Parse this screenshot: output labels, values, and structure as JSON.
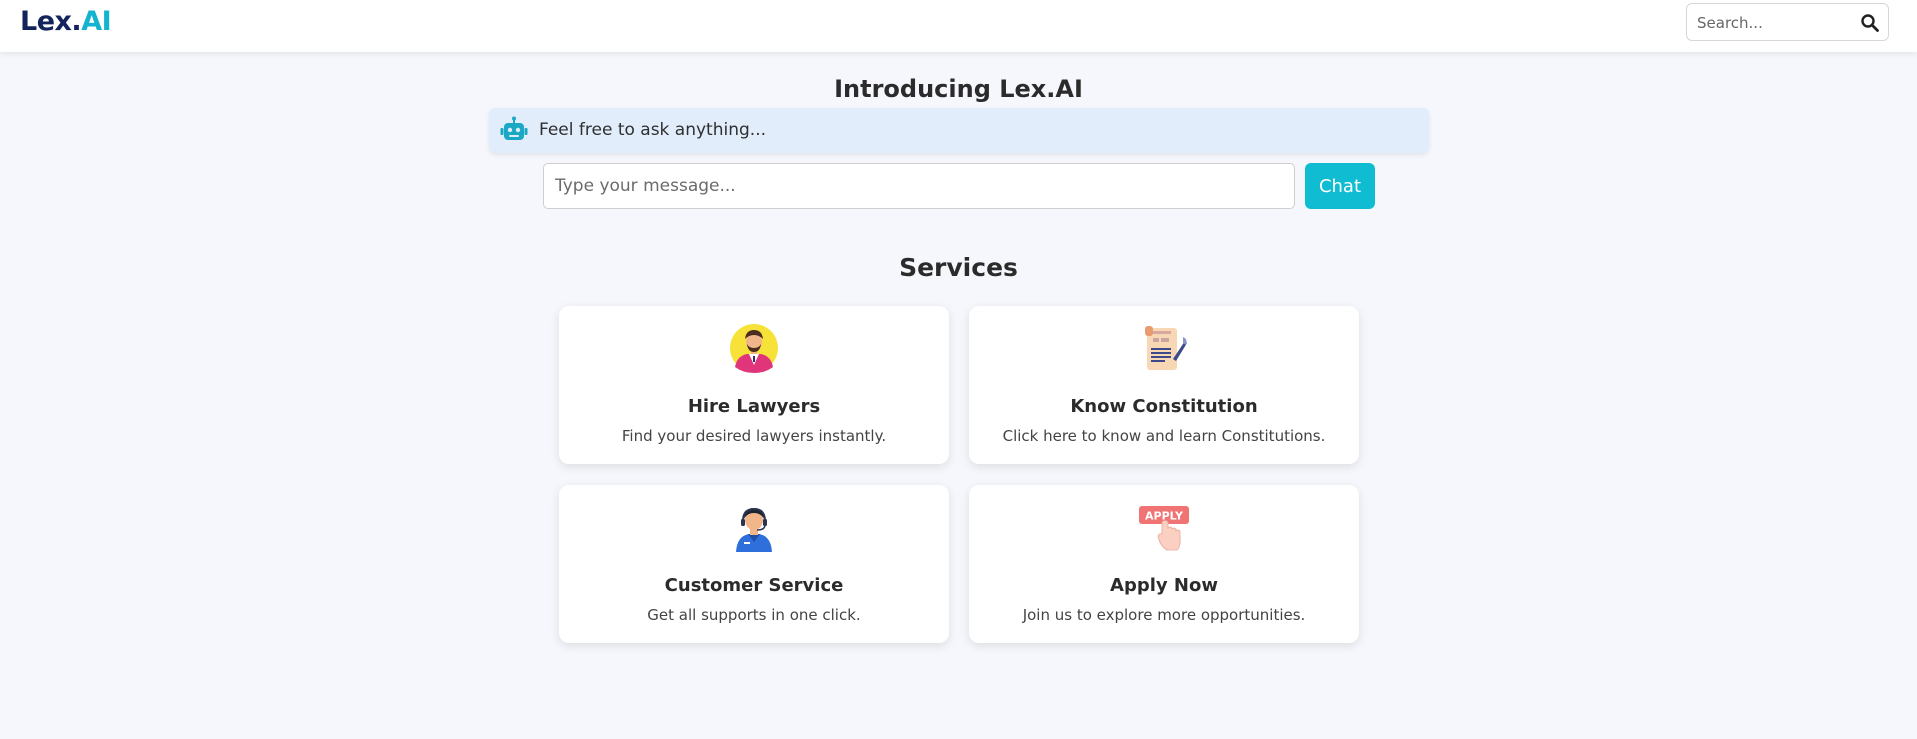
{
  "header": {
    "logo_primary": "Lex.",
    "logo_accent": "AI",
    "search_placeholder": "Search..."
  },
  "intro": {
    "title": "Introducing Lex.AI",
    "bot_message": "Feel free to ask anything...",
    "input_placeholder": "Type your message...",
    "chat_button": "Chat"
  },
  "services": {
    "title": "Services",
    "cards": [
      {
        "title": "Hire Lawyers",
        "desc": "Find your desired lawyers instantly.",
        "icon": "lawyer-icon"
      },
      {
        "title": "Know Constitution",
        "desc": "Click here to know and learn Constitutions.",
        "icon": "constitution-scroll-icon"
      },
      {
        "title": "Customer Service",
        "desc": "Get all supports in one click.",
        "icon": "support-agent-icon"
      },
      {
        "title": "Apply Now",
        "desc": "Join us to explore more opportunities.",
        "icon": "apply-icon",
        "icon_text": "APPLY"
      }
    ]
  },
  "colors": {
    "brand_dark": "#13235b",
    "accent": "#14b3cf",
    "chat_button": "#0fbcd1",
    "bot_bar": "#e2edfc",
    "page_bg": "#f5f7fc"
  }
}
